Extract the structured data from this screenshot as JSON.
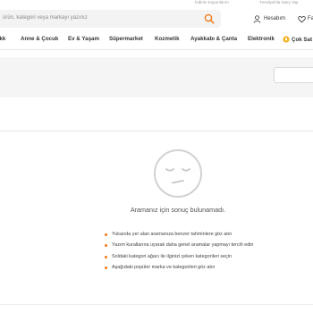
{
  "top_links": [
    {
      "label": "İndirim Kuponlarım"
    },
    {
      "label": "Trendyol'da Satış Yap"
    }
  ],
  "search": {
    "placeholder": "ürün, kategori veya markayı yazınız",
    "icon": "search-icon"
  },
  "header": {
    "account_label": "Hesabım",
    "favorites_label": "Fa"
  },
  "nav": {
    "items": [
      {
        "label": "ekk"
      },
      {
        "label": "Anne & Çocuk"
      },
      {
        "label": "Ev & Yaşam"
      },
      {
        "label": "Süpermarket"
      },
      {
        "label": "Kozmetik"
      },
      {
        "label": "Ayakkabı & Çanta"
      },
      {
        "label": "Elektronik"
      },
      {
        "label": "Çok Sat"
      }
    ]
  },
  "empty_state": {
    "icon": "sad-face-icon",
    "title": "Aramanız için sonuç bulunamadı.",
    "tips": [
      "Yukarıda yer alan aramanıza benzer tahminlere göz atın",
      "Yazım kurallarına uyarak daha genel aramalar yapmayı tercih edin",
      "Soldaki kategori ağacı ile ilginizi çeken kategorileri seçin",
      "Aşağıdaki popüler marka ve kategorileri göz atın"
    ]
  },
  "colors": {
    "accent": "#f27a1a",
    "text": "#333333",
    "muted": "#8a8a8a",
    "band": "#f5f5f5"
  }
}
